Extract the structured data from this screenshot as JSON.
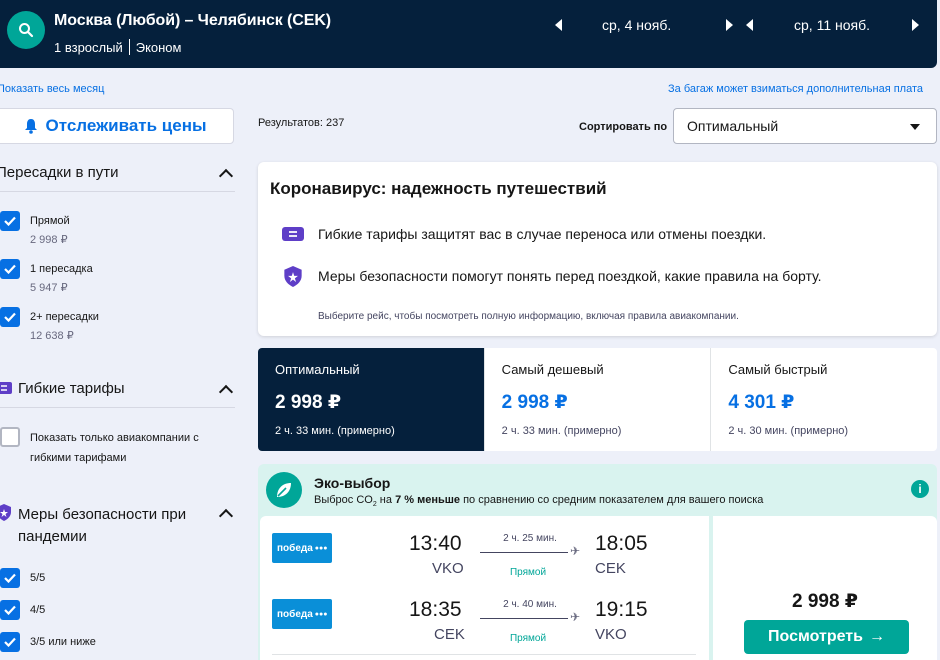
{
  "header": {
    "route": "Москва (Любой) – Челябинск (CEK)",
    "passengers": "1 взрослый",
    "cabin": "Эконом",
    "depart_date": "ср, 4 нояб.",
    "return_date": "ср, 11 нояб."
  },
  "links": {
    "whole_month": "Показать весь месяц",
    "baggage": "За багаж может взиматься дополнительная плата"
  },
  "sidebar": {
    "track_prices": "Отслеживать цены",
    "stops": {
      "title": "Пересадки в пути",
      "items": [
        {
          "label": "Прямой",
          "price": "2 998 ₽",
          "checked": true
        },
        {
          "label": "1 пересадка",
          "price": "5 947 ₽",
          "checked": true
        },
        {
          "label": "2+ пересадки",
          "price": "12 638 ₽",
          "checked": true
        }
      ]
    },
    "flex": {
      "title": "Гибкие тарифы",
      "option": "Показать только авиакомпании с гибкими тарифами"
    },
    "safety": {
      "title": "Меры безопасности при пандемии",
      "items": [
        {
          "label": "5/5",
          "checked": true
        },
        {
          "label": "4/5",
          "checked": true
        },
        {
          "label": "3/5 или ниже",
          "checked": true
        }
      ]
    }
  },
  "results": {
    "count": "Результатов: 237",
    "sort_label": "Сортировать по",
    "sort_value": "Оптимальный"
  },
  "covid": {
    "title": "Коронавирус: надежность путешествий",
    "line1": "Гибкие тарифы защитят вас в случае переноса или отмены поездки.",
    "line2": "Меры безопасности помогут понять перед поездкой, какие правила на борту.",
    "note": "Выберите рейс, чтобы посмотреть полную информацию, включая правила авиакомпании."
  },
  "tabs": [
    {
      "name": "Оптимальный",
      "price": "2 998 ₽",
      "time": "2 ч. 33 мин. (примерно)",
      "active": true
    },
    {
      "name": "Самый дешевый",
      "price": "2 998 ₽",
      "time": "2 ч. 33 мин. (примерно)",
      "active": false
    },
    {
      "name": "Самый быстрый",
      "price": "4 301 ₽",
      "time": "2 ч. 30 мин. (примерно)",
      "active": false
    }
  ],
  "eco": {
    "title": "Эко-выбор",
    "sub_prefix": "Выброс CO",
    "sub_mid": " на ",
    "sub_bold": "7 % меньше",
    "sub_suffix": " по сравнению со средним показателем для вашего поиска"
  },
  "flights": [
    {
      "airline": "победа",
      "dep_time": "13:40",
      "dep_code": "VKO",
      "duration": "2 ч. 25 мин.",
      "stops": "Прямой",
      "arr_time": "18:05",
      "arr_code": "CEK"
    },
    {
      "airline": "победа",
      "dep_time": "18:35",
      "dep_code": "CEK",
      "duration": "2 ч. 40 мин.",
      "stops": "Прямой",
      "arr_time": "19:15",
      "arr_code": "VKO"
    }
  ],
  "offer": {
    "price": "2 998 ₽",
    "button": "Посмотреть"
  }
}
